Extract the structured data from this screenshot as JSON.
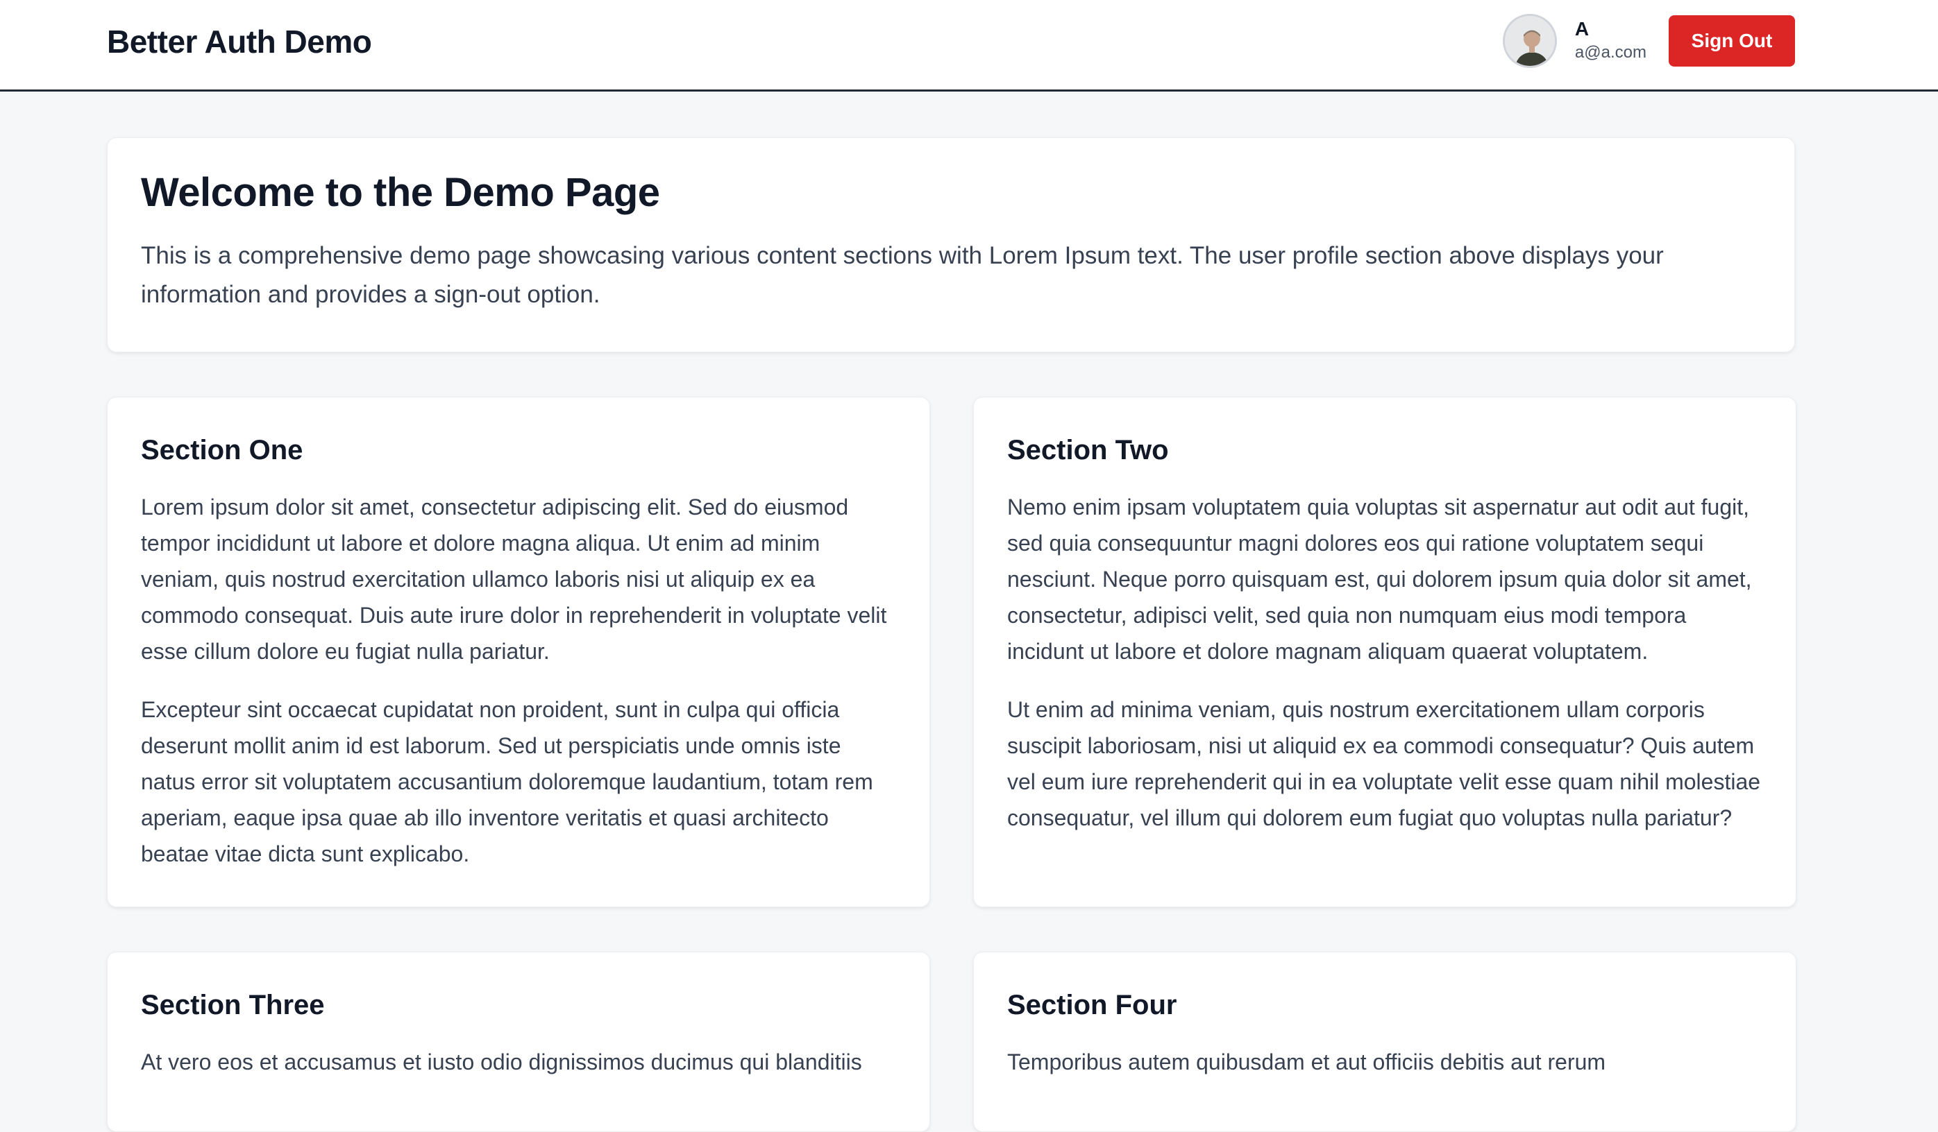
{
  "header": {
    "brand": "Better Auth Demo",
    "user": {
      "name": "A",
      "email": "a@a.com"
    },
    "sign_out_label": "Sign Out"
  },
  "hero": {
    "title": "Welcome to the Demo Page",
    "description": "This is a comprehensive demo page showcasing various content sections with Lorem Ipsum text. The user profile section above displays your information and provides a sign-out option."
  },
  "sections": [
    {
      "title": "Section One",
      "paragraphs": [
        "Lorem ipsum dolor sit amet, consectetur adipiscing elit. Sed do eiusmod tempor incididunt ut labore et dolore magna aliqua. Ut enim ad minim veniam, quis nostrud exercitation ullamco laboris nisi ut aliquip ex ea commodo consequat. Duis aute irure dolor in reprehenderit in voluptate velit esse cillum dolore eu fugiat nulla pariatur.",
        "Excepteur sint occaecat cupidatat non proident, sunt in culpa qui officia deserunt mollit anim id est laborum. Sed ut perspiciatis unde omnis iste natus error sit voluptatem accusantium doloremque laudantium, totam rem aperiam, eaque ipsa quae ab illo inventore veritatis et quasi architecto beatae vitae dicta sunt explicabo."
      ]
    },
    {
      "title": "Section Two",
      "paragraphs": [
        "Nemo enim ipsam voluptatem quia voluptas sit aspernatur aut odit aut fugit, sed quia consequuntur magni dolores eos qui ratione voluptatem sequi nesciunt. Neque porro quisquam est, qui dolorem ipsum quia dolor sit amet, consectetur, adipisci velit, sed quia non numquam eius modi tempora incidunt ut labore et dolore magnam aliquam quaerat voluptatem.",
        "Ut enim ad minima veniam, quis nostrum exercitationem ullam corporis suscipit laboriosam, nisi ut aliquid ex ea commodi consequatur? Quis autem vel eum iure reprehenderit qui in ea voluptate velit esse quam nihil molestiae consequatur, vel illum qui dolorem eum fugiat quo voluptas nulla pariatur?"
      ]
    },
    {
      "title": "Section Three",
      "paragraphs": [
        "At vero eos et accusamus et iusto odio dignissimos ducimus qui blanditiis"
      ]
    },
    {
      "title": "Section Four",
      "paragraphs": [
        "Temporibus autem quibusdam et aut officiis debitis aut rerum"
      ]
    }
  ],
  "colors": {
    "background": "#f6f7f9",
    "sign_out_button": "#dc2626",
    "text_primary": "#111827",
    "text_body": "#374151"
  },
  "icons": {
    "avatar": "user-avatar-photo"
  }
}
